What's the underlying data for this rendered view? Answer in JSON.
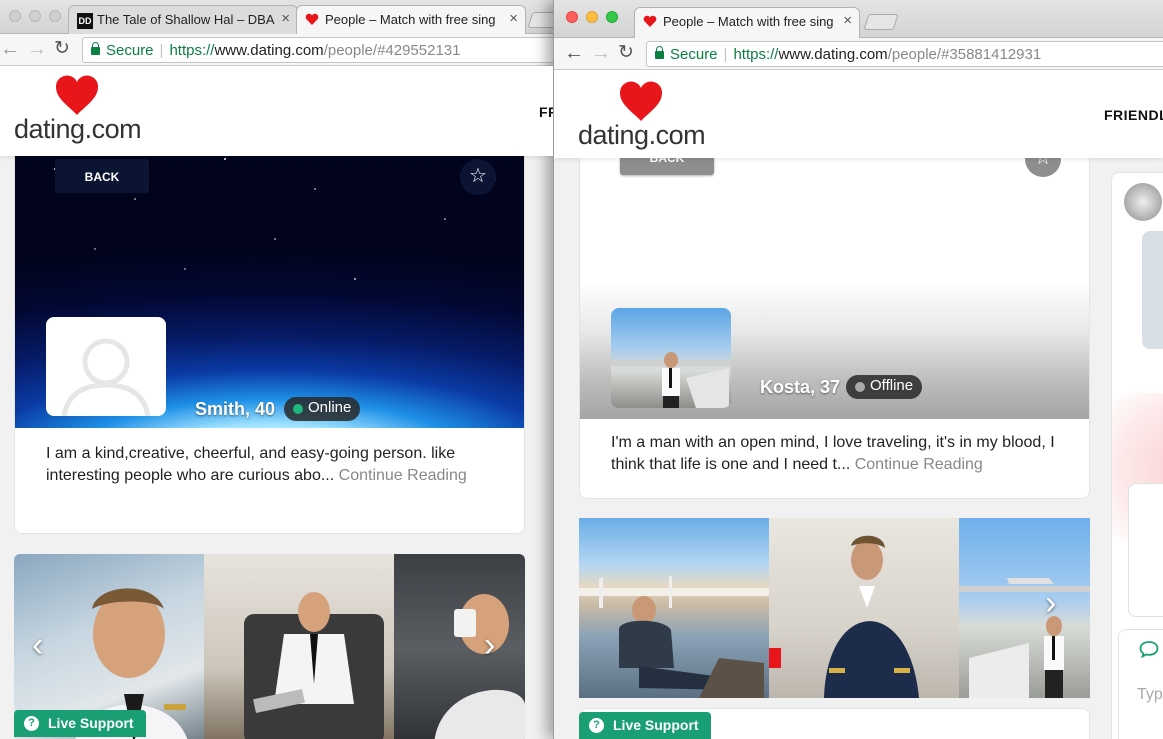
{
  "left_window": {
    "tabs": [
      {
        "favicon": "DD",
        "title": "The Tale of Shallow Hal – DBA"
      },
      {
        "title": "People – Match with free sing",
        "active": true
      }
    ],
    "omnibox": {
      "secure_label": "Secure",
      "scheme": "https://",
      "host": "www.dating.com",
      "path": "/people/#429552131"
    },
    "site": {
      "logo_text": "dating.com",
      "nav_partial": "FR",
      "back_label": "BACK",
      "profile": {
        "name": "Smith, 40",
        "status": "Online"
      },
      "bio": "I am a kind,creative, cheerful, and easy-going person. like interesting people who are curious abo...",
      "continue_label": "Continue Reading",
      "live_support": "Live Support"
    }
  },
  "right_window": {
    "tabs": [
      {
        "title": "People – Match with free sing",
        "active": true
      }
    ],
    "omnibox": {
      "secure_label": "Secure",
      "scheme": "https://",
      "host": "www.dating.com",
      "path": "/people/#35881412931"
    },
    "site": {
      "logo_text": "dating.com",
      "nav_partial": "FRIENDL",
      "back_label": "BACK",
      "profile": {
        "name": "Kosta, 37",
        "status": "Offline"
      },
      "bio": "I'm a man with an open mind, I love traveling, it's in my blood, I think that life is one and I need t...",
      "continue_label": "Continue Reading",
      "live_support": "Live Support",
      "chat_placeholder_partial": "Type"
    }
  },
  "colors": {
    "brand_red": "#e8151b",
    "online_green": "#1db87e",
    "offline_gray": "#aaaaaa",
    "live_support_green": "#1a9f75"
  },
  "icons": [
    "back-arrow-icon",
    "forward-arrow-icon",
    "reload-icon",
    "lock-icon",
    "star-icon",
    "chevron-left-icon",
    "chevron-right-icon",
    "question-icon",
    "chat-bubble-icon",
    "heart-logo-icon",
    "user-placeholder-icon"
  ]
}
